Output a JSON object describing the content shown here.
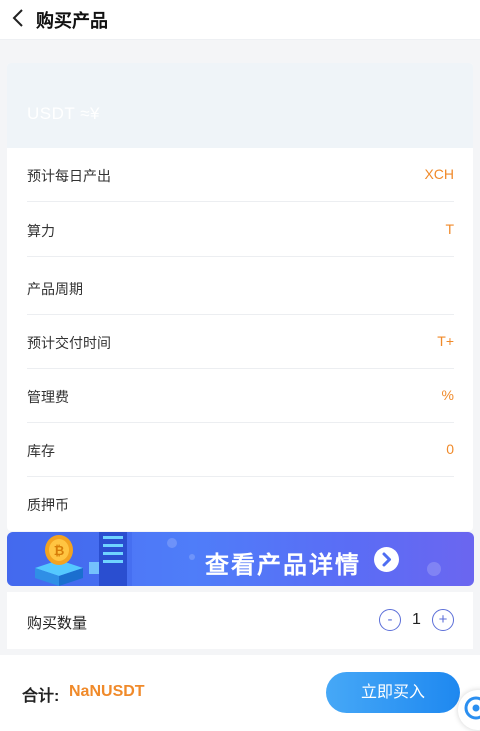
{
  "header": {
    "title": "购买产品"
  },
  "product": {
    "price_text": "USDT ≈¥",
    "rows": [
      {
        "label": "预计每日产出",
        "value": "XCH"
      },
      {
        "label": "算力",
        "value": "T"
      },
      {
        "label": "产品周期",
        "value": ""
      },
      {
        "label": "预计交付时间",
        "value": "T+"
      },
      {
        "label": "管理费",
        "value": "%"
      },
      {
        "label": "库存",
        "value": "0"
      },
      {
        "label": "质押币",
        "value": ""
      }
    ]
  },
  "banner": {
    "text": "查看产品详情"
  },
  "quantity": {
    "label": "购买数量",
    "minus": "-",
    "value": "1",
    "plus": "+"
  },
  "footer": {
    "total_label": "合计:",
    "total_value": "NaNUSDT",
    "buy_label": "立即买入"
  },
  "colors": {
    "accent": "#f08a2a",
    "primary": "#1e88f0",
    "banner": "#4f7df9"
  }
}
